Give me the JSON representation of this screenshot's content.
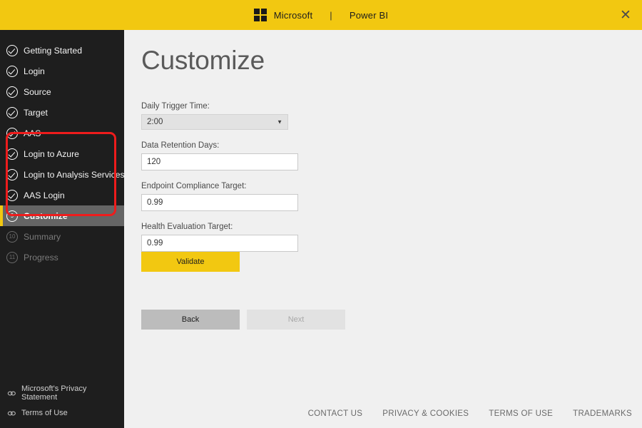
{
  "titlebar": {
    "logo_icon": "microsoft-grid-icon",
    "company": "Microsoft",
    "separator": "|",
    "product": "Power BI",
    "close_label": "✕",
    "background_color": "#f2c811"
  },
  "sidebar": {
    "background_color": "#1e1e1e",
    "active_indicator_color": "#f2c811",
    "items": [
      {
        "label": "Getting Started",
        "icon": "check-circle-icon",
        "state": "complete"
      },
      {
        "label": "Login",
        "icon": "check-circle-icon",
        "state": "complete"
      },
      {
        "label": "Source",
        "icon": "check-circle-icon",
        "state": "complete"
      },
      {
        "label": "Target",
        "icon": "check-circle-icon",
        "state": "complete"
      },
      {
        "label": "AAS",
        "icon": "check-circle-icon",
        "state": "complete"
      },
      {
        "label": "Login to Azure",
        "icon": "check-circle-icon",
        "state": "complete"
      },
      {
        "label": "Login to Analysis Services",
        "icon": "check-circle-icon",
        "state": "complete"
      },
      {
        "label": "AAS Login",
        "icon": "check-circle-icon",
        "state": "complete"
      },
      {
        "label": "Customize",
        "icon": "number-circle-icon",
        "number": "9",
        "state": "active"
      },
      {
        "label": "Summary",
        "icon": "number-circle-icon",
        "number": "10",
        "state": "disabled"
      },
      {
        "label": "Progress",
        "icon": "number-circle-icon",
        "number": "11",
        "state": "disabled"
      }
    ],
    "links": [
      {
        "label": "Microsoft's Privacy Statement",
        "icon": "link-icon"
      },
      {
        "label": "Terms of Use",
        "icon": "link-icon"
      }
    ]
  },
  "annotation": {
    "color": "#ee1c1c",
    "covers": [
      "AAS",
      "Login to Azure",
      "Login to Analysis Services",
      "AAS Login"
    ]
  },
  "main": {
    "title": "Customize",
    "fields": {
      "trigger_time": {
        "label": "Daily Trigger Time:",
        "value": "2:00",
        "arrow_icon": "chevron-down-icon"
      },
      "retention_days": {
        "label": "Data Retention Days:",
        "value": "120"
      },
      "endpoint_compliance": {
        "label": "Endpoint Compliance Target:",
        "value": "0.99"
      },
      "health_evaluation": {
        "label": "Health Evaluation Target:",
        "value": "0.99"
      }
    },
    "buttons": {
      "validate": "Validate",
      "back": "Back",
      "next": "Next"
    }
  },
  "footer": {
    "links": [
      {
        "label": "CONTACT US"
      },
      {
        "label": "PRIVACY & COOKIES"
      },
      {
        "label": "TERMS OF USE"
      },
      {
        "label": "TRADEMARKS"
      }
    ]
  }
}
